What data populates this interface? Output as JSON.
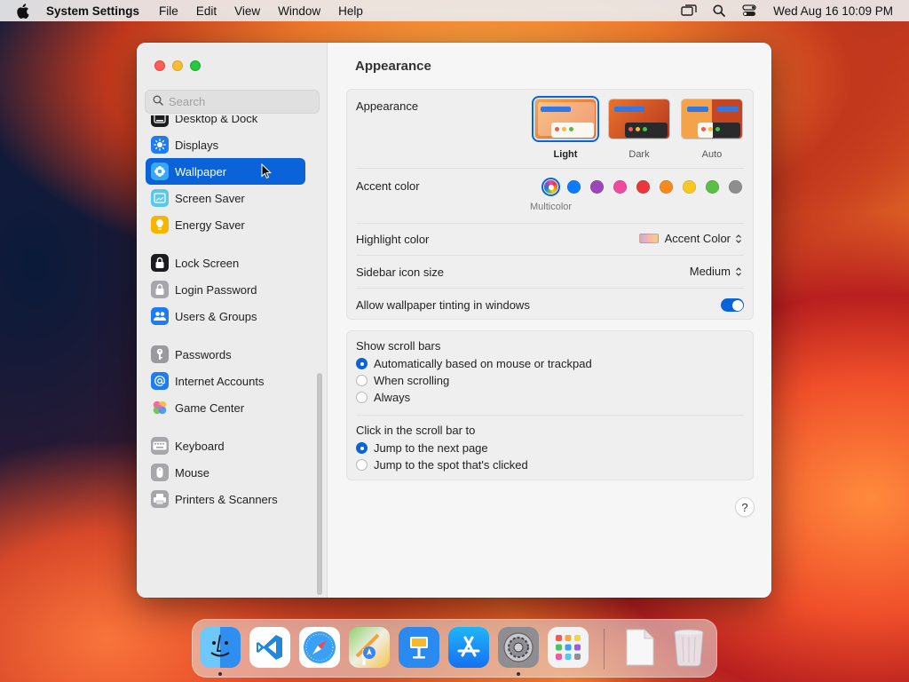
{
  "menubar": {
    "app_name": "System Settings",
    "menus": [
      "File",
      "Edit",
      "View",
      "Window",
      "Help"
    ],
    "clock": "Wed Aug 16  10:09 PM",
    "icons": [
      "screen-mirroring-icon",
      "spotlight-icon",
      "control-center-icon"
    ]
  },
  "sidebar": {
    "search_placeholder": "Search",
    "items": [
      {
        "label": "Desktop & Dock",
        "icon": "dock-icon"
      },
      {
        "label": "Displays",
        "icon": "displays-icon"
      },
      {
        "label": "Wallpaper",
        "icon": "wallpaper-icon",
        "selected": true
      },
      {
        "label": "Screen Saver",
        "icon": "screen-saver-icon"
      },
      {
        "label": "Energy Saver",
        "icon": "energy-saver-icon"
      },
      {
        "label": "Lock Screen",
        "icon": "lock-icon"
      },
      {
        "label": "Login Password",
        "icon": "login-password-icon"
      },
      {
        "label": "Users & Groups",
        "icon": "users-icon"
      },
      {
        "label": "Passwords",
        "icon": "key-icon"
      },
      {
        "label": "Internet Accounts",
        "icon": "at-icon"
      },
      {
        "label": "Game Center",
        "icon": "game-center-icon"
      },
      {
        "label": "Keyboard",
        "icon": "keyboard-icon"
      },
      {
        "label": "Mouse",
        "icon": "mouse-icon"
      },
      {
        "label": "Printers & Scanners",
        "icon": "printer-icon"
      }
    ]
  },
  "main": {
    "title": "Appearance",
    "appearance": {
      "label": "Appearance",
      "options": [
        "Light",
        "Dark",
        "Auto"
      ],
      "selected": "Light"
    },
    "accent": {
      "label": "Accent color",
      "selected_label": "Multicolor",
      "colors": [
        "#0a7cff",
        "#9a48b8",
        "#f04a9f",
        "#e8383b",
        "#f58a1f",
        "#f7c824",
        "#5dbd47",
        "#8e8e8e"
      ]
    },
    "highlight": {
      "label": "Highlight color",
      "value": "Accent Color"
    },
    "sidebar_icon_size": {
      "label": "Sidebar icon size",
      "value": "Medium"
    },
    "tinting": {
      "label": "Allow wallpaper tinting in windows",
      "enabled": true
    },
    "scroll_bars": {
      "label": "Show scroll bars",
      "options": [
        "Automatically based on mouse or trackpad",
        "When scrolling",
        "Always"
      ],
      "selected": 0
    },
    "click_scroll": {
      "label": "Click in the scroll bar to",
      "options": [
        "Jump to the next page",
        "Jump to the spot that's clicked"
      ],
      "selected": 0
    },
    "help_label": "?"
  },
  "dock": {
    "apps": [
      "finder-icon",
      "vscode-icon",
      "safari-icon",
      "maps-icon",
      "keynote-icon",
      "app-store-icon",
      "system-settings-icon",
      "launchpad-icon",
      "document-icon",
      "trash-icon"
    ]
  },
  "colors": {
    "accent": "#0a63d8"
  }
}
